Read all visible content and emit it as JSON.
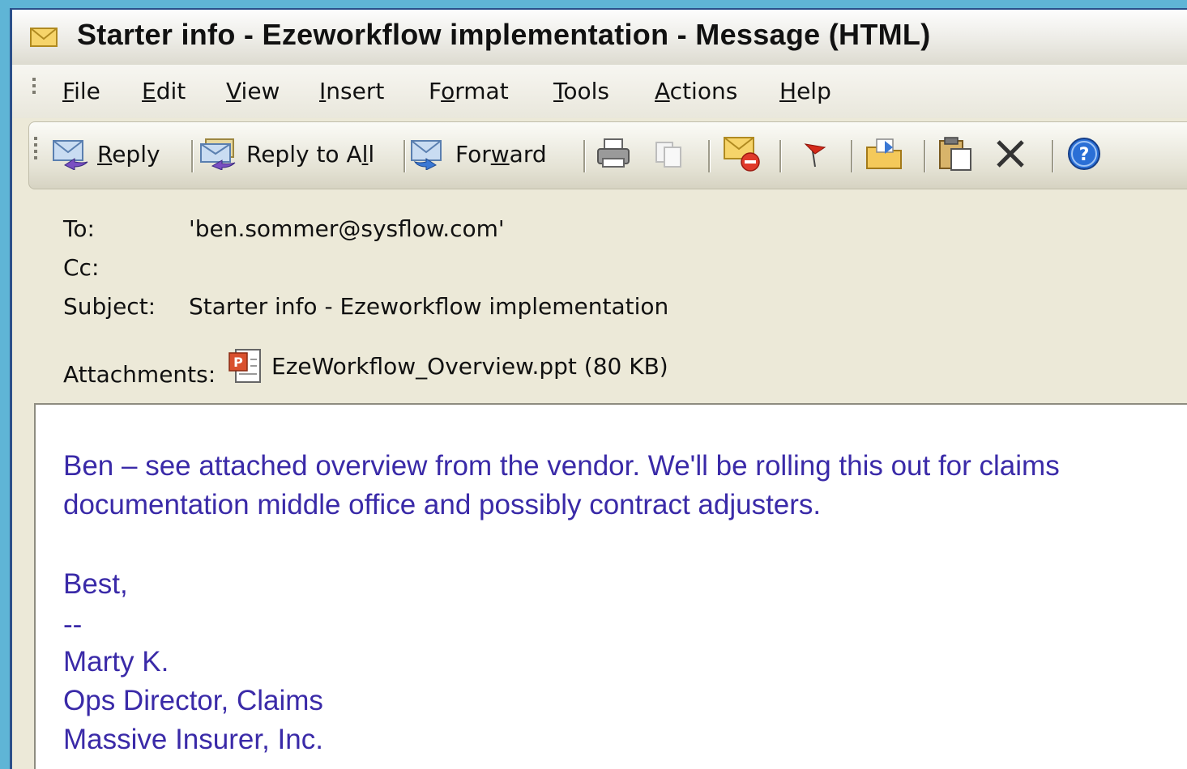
{
  "window": {
    "title": "Starter info - Ezeworkflow implementation - Message (HTML)"
  },
  "menu": {
    "items": [
      {
        "key": "F",
        "rest": "ile"
      },
      {
        "key": "E",
        "rest": "dit"
      },
      {
        "key": "V",
        "rest": "iew"
      },
      {
        "key": "I",
        "rest": "nsert"
      },
      {
        "pre": "F",
        "key": "o",
        "rest": "rmat"
      },
      {
        "key": "T",
        "rest": "ools"
      },
      {
        "key": "A",
        "rest": "ctions"
      },
      {
        "key": "H",
        "rest": "elp"
      }
    ]
  },
  "toolbar": {
    "reply_key": "R",
    "reply_rest": "eply",
    "reply_all_pre": "Reply to A",
    "reply_all_key": "l",
    "reply_all_rest": "l",
    "forward_pre": "For",
    "forward_key": "w",
    "forward_rest": "ard"
  },
  "header": {
    "to_label": "To:",
    "to_value": "'ben.sommer@sysflow.com'",
    "cc_label": "Cc:",
    "cc_value": "",
    "subject_label": "Subject:",
    "subject_value": "Starter info - Ezeworkflow implementation",
    "attachments_label": "Attachments:",
    "attachment_name": "EzeWorkflow_Overview.ppt (80 KB)"
  },
  "message": {
    "line1": "Ben – see attached overview from the vendor. We'll be rolling this out for claims",
    "line2": "documentation middle office and possibly contract adjusters.",
    "closing": "Best,",
    "sig_sep": "--",
    "sig_name": "Marty K.",
    "sig_title": "Ops Director, Claims",
    "sig_company": "Massive Insurer, Inc."
  },
  "colors": {
    "body_text": "#3a2aa8",
    "background": "#5fb5d6",
    "chrome": "#ece9d8"
  },
  "icons": [
    "envelope-icon",
    "reply-icon",
    "reply-all-icon",
    "forward-icon",
    "print-icon",
    "copy-icon",
    "delete-mail-icon",
    "flag-icon",
    "move-folder-icon",
    "paste-icon",
    "close-x-icon",
    "help-icon",
    "ppt-file-icon"
  ]
}
